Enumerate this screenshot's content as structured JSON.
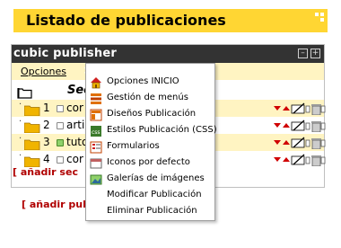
{
  "page": {
    "title": "Listado de publicaciones"
  },
  "panel": {
    "name": "cubic publisher",
    "minimize_label": "[-]",
    "maximize_label": "[+]",
    "toolbar": {
      "opciones_label": "Opciones",
      "arrow": ">"
    }
  },
  "tree": {
    "root_label": "Sec",
    "rows": [
      {
        "num": "1",
        "label": "cor",
        "status": "inactive"
      },
      {
        "num": "2",
        "label": "arti",
        "status": "inactive"
      },
      {
        "num": "3",
        "label": "tuto",
        "status": "active"
      },
      {
        "num": "4",
        "label": "cor",
        "status": "inactive"
      }
    ]
  },
  "links": {
    "add_section": "[ añadir sec",
    "add_publication": "[ añadir publ"
  },
  "menu": {
    "items": [
      {
        "label": "Opciones INICIO",
        "icon": "home-icon"
      },
      {
        "label": "Gestión de menús",
        "icon": "menu-list-icon"
      },
      {
        "label": "Diseños Publicación",
        "icon": "layout-icon"
      },
      {
        "label": "Estilos Publicación (CSS)",
        "icon": "css-icon"
      },
      {
        "label": "Formularios",
        "icon": "form-icon"
      },
      {
        "label": "Iconos por defecto",
        "icon": "default-icon"
      },
      {
        "label": "Galerías de imágenes",
        "icon": "image-gallery-icon"
      },
      {
        "label": "Modificar Publicación",
        "icon": ""
      },
      {
        "label": "Eliminar Publicación",
        "icon": ""
      }
    ]
  },
  "colors": {
    "title_bar": "#ffd633",
    "panel_header": "#333333",
    "row_alt": "#fff4c2",
    "link_red": "#b00000",
    "folder": "#f0b400"
  }
}
